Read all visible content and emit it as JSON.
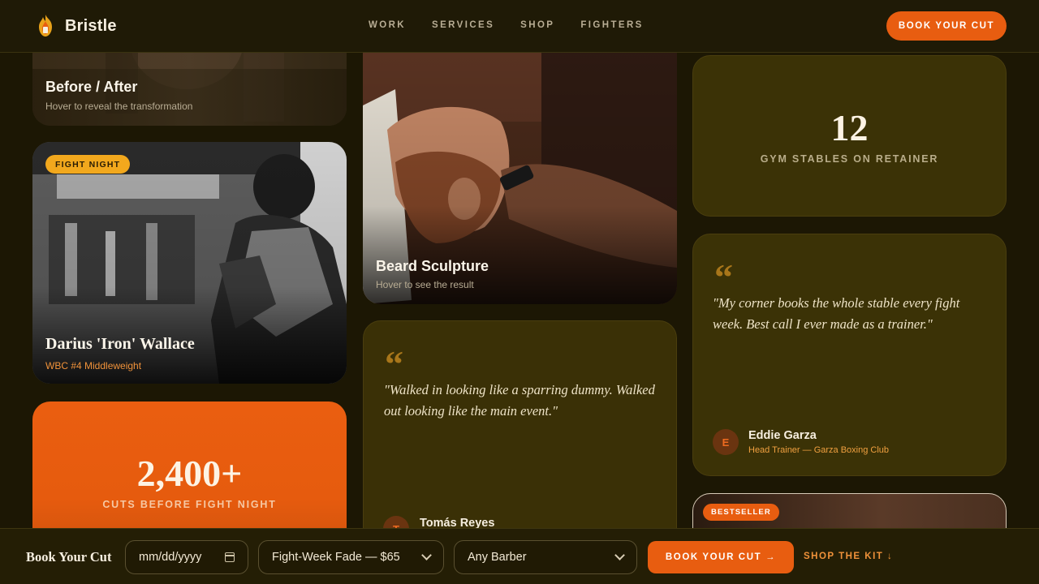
{
  "brand": {
    "name": "Bristle",
    "logo_icon": "flame-shield-icon",
    "accent": "#e85d10"
  },
  "nav": {
    "items": [
      "WORK",
      "SERVICES",
      "SHOP",
      "FIGHTERS"
    ]
  },
  "header": {
    "cta_label": "BOOK YOUR CUT"
  },
  "before_after": {
    "title": "Before / After",
    "subtitle": "Hover to reveal the transformation"
  },
  "fighter": {
    "badge": "FIGHT NIGHT",
    "name": "Darius 'Iron' Wallace",
    "rank": "WBC #4 Middleweight"
  },
  "stat_cuts": {
    "value": "2,400+",
    "label": "CUTS BEFORE FIGHT NIGHT"
  },
  "beard": {
    "title": "Beard Sculpture",
    "subtitle": "Hover to see the result"
  },
  "quote_tomas": {
    "mark": "“",
    "text": "\"Walked in looking like a sparring dummy. Walked out looking like the main event.\"",
    "name": "Tomás Reyes",
    "initial": "T"
  },
  "stat_gyms": {
    "value": "12",
    "label": "GYM STABLES ON RETAINER"
  },
  "quote_eddie": {
    "mark": "“",
    "text": "\"My corner books the whole stable every fight week. Best call I ever made as a trainer.\"",
    "name": "Eddie Garza",
    "role": "Head Trainer — Garza Boxing Club",
    "initial": "E"
  },
  "bestseller": {
    "badge": "BESTSELLER"
  },
  "booking": {
    "title": "Book Your Cut",
    "date_placeholder": "mm/dd/yyyy",
    "service_selected": "Fight-Week Fade — $65",
    "barber_selected": "Any Barber",
    "cta_label": "BOOK YOUR CUT →",
    "shop_link": "SHOP THE KIT ↓"
  }
}
